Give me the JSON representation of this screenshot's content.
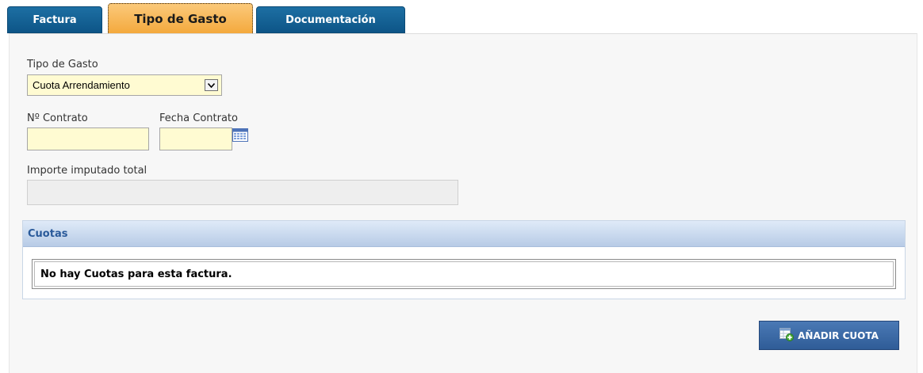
{
  "tabs": [
    {
      "label": "Factura",
      "active": false
    },
    {
      "label": "Tipo de Gasto",
      "active": true
    },
    {
      "label": "Documentación",
      "active": false
    }
  ],
  "form": {
    "tipo_gasto_label": "Tipo de Gasto",
    "tipo_gasto_value": "Cuota Arrendamiento",
    "contrato_label": "Nº Contrato",
    "contrato_value": "",
    "fecha_label": "Fecha Contrato",
    "fecha_value": "",
    "importe_label": "Importe imputado total",
    "importe_value": ""
  },
  "cuotas": {
    "title": "Cuotas",
    "empty_message": "No hay Cuotas para esta factura."
  },
  "actions": {
    "add_label": "AÑADIR CUOTA"
  },
  "colors": {
    "tab_inactive": "#0d5587",
    "tab_active": "#f4a93d",
    "field_bg": "#fffbd2",
    "button": "#2f5c97"
  }
}
